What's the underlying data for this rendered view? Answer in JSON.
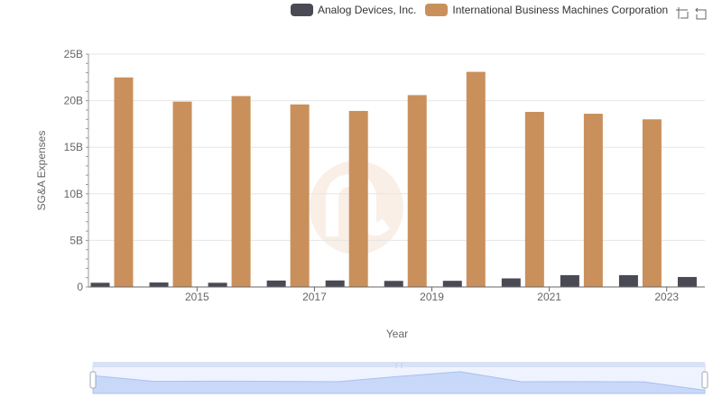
{
  "legend": {
    "series_0": "Analog Devices, Inc.",
    "series_1": "International Business Machines Corporation"
  },
  "toolbox": {
    "zoom_icon": "data-zoom-icon",
    "restore_icon": "restore-icon"
  },
  "colors": {
    "series_0": "#4a4a55",
    "series_1": "#c9905c",
    "grid": "#e6e6e6",
    "zoom_fill": "#d6e4ff"
  },
  "chart_data": {
    "type": "bar",
    "xlabel": "Year",
    "ylabel": "SG&A Expenses",
    "x_tick_labels": [
      "2015",
      "2017",
      "2019",
      "2021",
      "2023"
    ],
    "y_tick_labels": [
      "0",
      "5B",
      "10B",
      "15B",
      "20B",
      "25B"
    ],
    "ylim": [
      0,
      25000000000
    ],
    "grid": true,
    "legend_position": "top",
    "categories": [
      "2014",
      "2015",
      "2016",
      "2017",
      "2018",
      "2019",
      "2020",
      "2021",
      "2022",
      "2023",
      "2024"
    ],
    "series": [
      {
        "name": "Analog Devices, Inc.",
        "values": [
          450000000,
          480000000,
          450000000,
          690000000,
          700000000,
          650000000,
          660000000,
          920000000,
          1270000000,
          1270000000,
          1070000000
        ]
      },
      {
        "name": "International Business Machines Corporation",
        "values": [
          22500000000,
          19900000000,
          20500000000,
          19600000000,
          18900000000,
          20600000000,
          23100000000,
          18800000000,
          18600000000,
          18000000000,
          null
        ]
      }
    ]
  }
}
